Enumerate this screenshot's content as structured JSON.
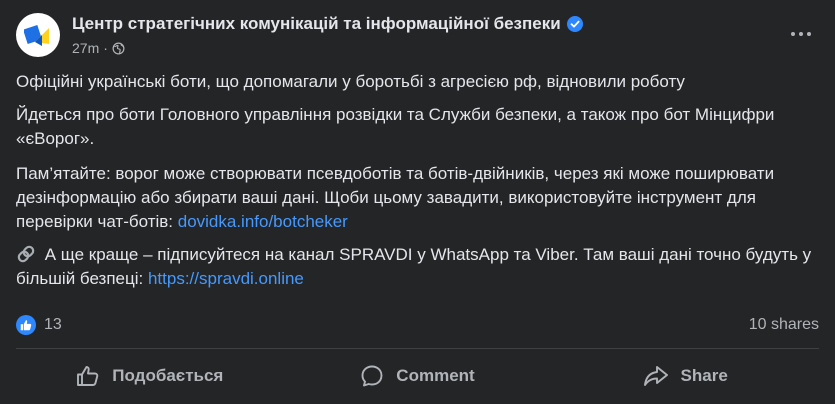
{
  "post": {
    "author": "Центр стратегічних комунікацій та інформаційної безпеки",
    "time": "27m",
    "separator": "·",
    "paragraphs": {
      "p1": "Офіційні українські боти, що допомагали у боротьбі з агресією рф, відновили роботу",
      "p2": "Йдеться про боти Головного управління розвідки та Служби безпеки, а також про бот Мінцифри «єВорог».",
      "p3_text": "Пам’ятайте: ворог може створювати псевдоботів та ботів-двійників, через які може поширювати дезінформацію або збирати ваші дані. Щоби цьому завадити, використовуйте інструмент для перевірки чат-ботів: ",
      "p3_link": "dovidka.info/botcheker",
      "p4_text": " А ще краще – підписуйтеся на канал SPRAVDI у WhatsApp та Viber. Там ваші дані точно будуть у більшій безпеці: ",
      "p4_link": "https://spravdi.online"
    },
    "stats": {
      "likes": "13",
      "shares": "10 shares"
    },
    "actions": {
      "like": "Подобається",
      "comment": "Comment",
      "share": "Share"
    }
  },
  "icons": {
    "verified": "verified-badge-icon",
    "audience": "globe-icon",
    "more": "more-options-icon",
    "link": "link-emoji-icon",
    "like": "thumbs-up-icon",
    "comment": "comment-icon",
    "share": "share-icon"
  },
  "colors": {
    "background": "#242526",
    "text": "#e4e6eb",
    "secondary": "#b0b3b8",
    "link": "#4599ff",
    "like_blue": "#2d88ff",
    "logo_blue": "#1f6fe5",
    "logo_yellow": "#ffd21f"
  }
}
